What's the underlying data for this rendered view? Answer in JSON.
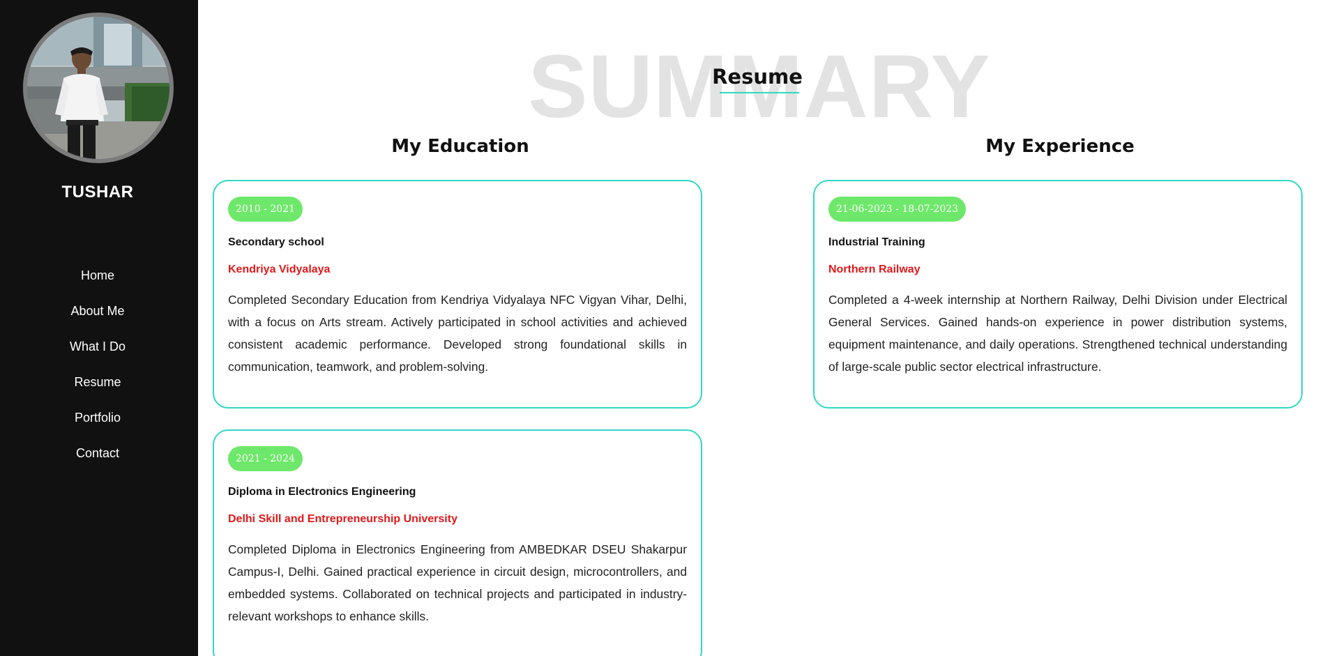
{
  "sidebar": {
    "name": "TUSHAR",
    "nav": [
      "Home",
      "About Me",
      "What I Do",
      "Resume",
      "Portfolio",
      "Contact"
    ]
  },
  "section": {
    "background_word": "SUMMARY",
    "title": "Resume"
  },
  "education": {
    "heading": "My Education",
    "items": [
      {
        "dates": "2010 - 2021",
        "title": "Secondary school",
        "org": "Kendriya Vidyalaya",
        "description": "Completed Secondary Education from Kendriya Vidyalaya NFC Vigyan Vihar, Delhi, with a focus on Arts stream. Actively participated in school activities and achieved consistent academic performance. Developed strong foundational skills in communication, teamwork, and problem-solving."
      },
      {
        "dates": "2021 - 2024",
        "title": "Diploma in Electronics Engineering",
        "org": "Delhi Skill and Entrepreneurship University",
        "description": "Completed Diploma in Electronics Engineering from AMBEDKAR DSEU Shakarpur Campus-I, Delhi. Gained practical experience in circuit design, microcontrollers, and embedded systems. Collaborated on technical projects and participated in industry-relevant workshops to enhance skills."
      }
    ]
  },
  "experience": {
    "heading": "My Experience",
    "items": [
      {
        "dates": "21-06-2023 - 18-07-2023",
        "title": "Industrial Training",
        "org": "Northern Railway",
        "description": "Completed a 4-week internship at Northern Railway, Delhi Division under Electrical General Services. Gained hands-on experience in power distribution systems, equipment maintenance, and daily operations. Strengthened technical understanding of large-scale public sector electrical infrastructure."
      }
    ]
  },
  "colors": {
    "sidebar_bg": "#111111",
    "accent_border": "#2fd8c4",
    "badge_bg": "#6ee86a",
    "org_text": "#e0191b",
    "bg_word": "#e3e3e3"
  }
}
